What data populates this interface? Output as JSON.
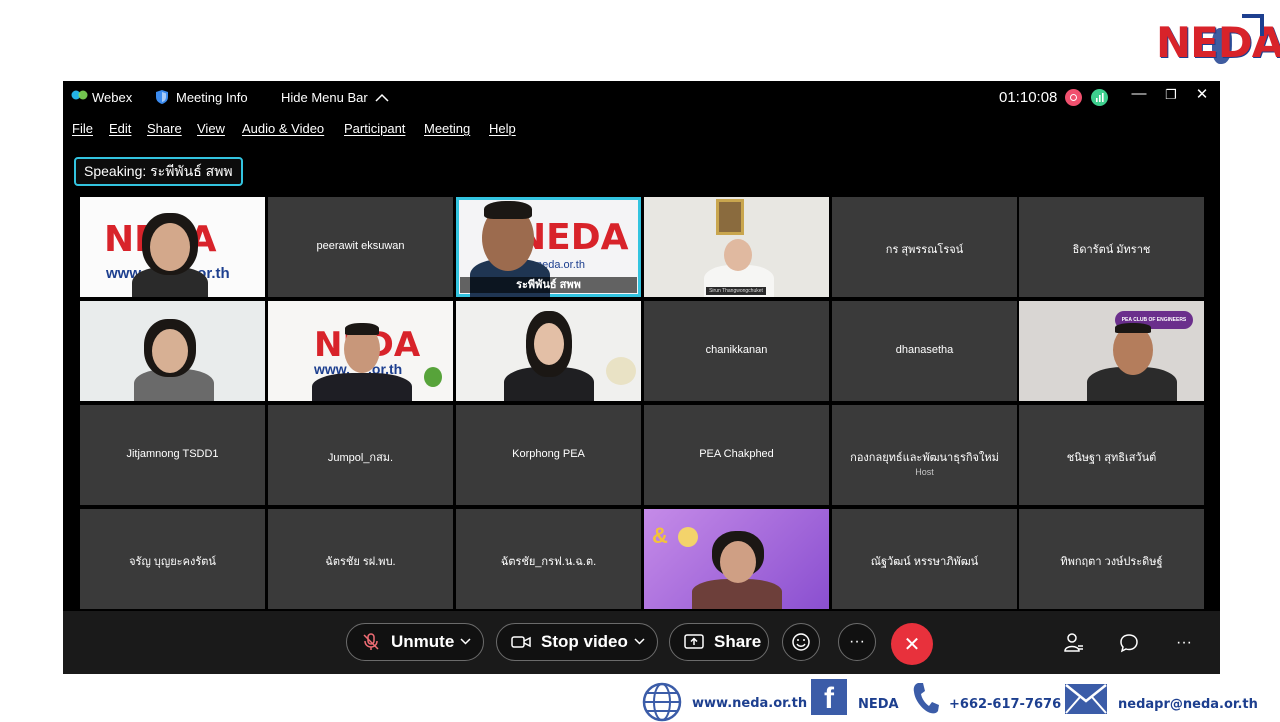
{
  "corner_logo": {
    "text": "NEDA"
  },
  "titlebar": {
    "app_name": "Webex",
    "meeting_info": "Meeting Info",
    "hide_menu": "Hide Menu Bar",
    "timer": "01:10:08",
    "minimize": "—",
    "restore": "❐",
    "close": "✕"
  },
  "menu": [
    "File",
    "Edit",
    "Share",
    "View",
    "Audio & Video",
    "Participant",
    "Meeting",
    "Help"
  ],
  "speaking": "Speaking: ระพีพันธ์ สพพ",
  "tiles": [
    {
      "name": "",
      "kind": "video"
    },
    {
      "name": "peerawit eksuwan",
      "kind": "name"
    },
    {
      "name": "ระพีพันธ์ สพพ",
      "kind": "video"
    },
    {
      "name": "",
      "kind": "video"
    },
    {
      "name": "กร สุพรรณโรจน์",
      "kind": "name"
    },
    {
      "name": "ธิดารัตน์ มัทราช",
      "kind": "name"
    },
    {
      "name": "",
      "kind": "video"
    },
    {
      "name": "",
      "kind": "video"
    },
    {
      "name": "",
      "kind": "video"
    },
    {
      "name": "chanikkanan",
      "kind": "name"
    },
    {
      "name": "dhanasetha",
      "kind": "name"
    },
    {
      "name": "",
      "kind": "video"
    },
    {
      "name": "Jitjamnong TSDD1",
      "kind": "name"
    },
    {
      "name": "Jumpol_กสม.",
      "kind": "name"
    },
    {
      "name": "Korphong PEA",
      "kind": "name"
    },
    {
      "name": "PEA Chakphed",
      "kind": "name"
    },
    {
      "name": "กองกลยุทธ์และพัฒนาธุรกิจใหม่",
      "kind": "name",
      "sub": "Host"
    },
    {
      "name": "ชนิษฐา สุทธิเสวันต์",
      "kind": "name"
    },
    {
      "name": "จรัญ บุญยะคงรัตน์",
      "kind": "name"
    },
    {
      "name": "ฉัตรชัย รฝ.พบ.",
      "kind": "name"
    },
    {
      "name": "ฉัตรชัย_กรฟ.น.ฉ.ต.",
      "kind": "name"
    },
    {
      "name": "",
      "kind": "video"
    },
    {
      "name": "ณัฐวัฒน์ หรรษาภิพัฒน์",
      "kind": "name"
    },
    {
      "name": "ทิพกฤตา วงษ์ประดิษฐ์",
      "kind": "name"
    }
  ],
  "tile_visuals": {
    "neda_text": "NEDA",
    "neda_url_partial": "www.",
    "neda_url_tail": ".or.th",
    "neda_url_speaker": "neda.or.th",
    "nameplate": "Sirun Thangwongchuket",
    "pea_badge": "PEA CLUB OF ENGINEERS",
    "amp": "&"
  },
  "controls": {
    "unmute": "Unmute",
    "stop_video": "Stop video",
    "share": "Share",
    "end_icon": "✕",
    "more": "···"
  },
  "footer": {
    "website": "www.neda.or.th",
    "facebook": "NEDA",
    "fb_letter": "f",
    "phone": "+662-617-7676",
    "email": "nedapr@neda.or.th"
  }
}
